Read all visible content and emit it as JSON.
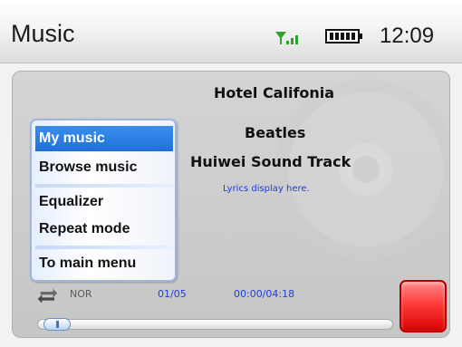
{
  "status_bar": {
    "app_title": "Music",
    "clock": "12:09",
    "signal_icon": "signal-icon",
    "battery_icon": "battery-icon"
  },
  "now_playing": {
    "song_title": "Hotel Califonia",
    "artist": "Beatles",
    "album": "Huiwei Sound Track",
    "lyrics_placeholder": "Lyrics display here."
  },
  "menu": {
    "items": [
      {
        "label": "My music",
        "selected": true
      },
      {
        "label": "Browse music",
        "selected": false
      },
      {
        "label": "Equalizer",
        "selected": false
      },
      {
        "label": "Repeat mode",
        "selected": false
      },
      {
        "label": "To main menu",
        "selected": false
      }
    ]
  },
  "playback": {
    "mode": "NOR",
    "track": "01/05",
    "time": "00:00/04:18",
    "progress_fraction": 0.0
  },
  "colors": {
    "accent_blue": "#1f6fd8",
    "info_text": "#1c3ce0",
    "stop_red": "#ff3b3b",
    "signal_green": "#2aa52a"
  }
}
